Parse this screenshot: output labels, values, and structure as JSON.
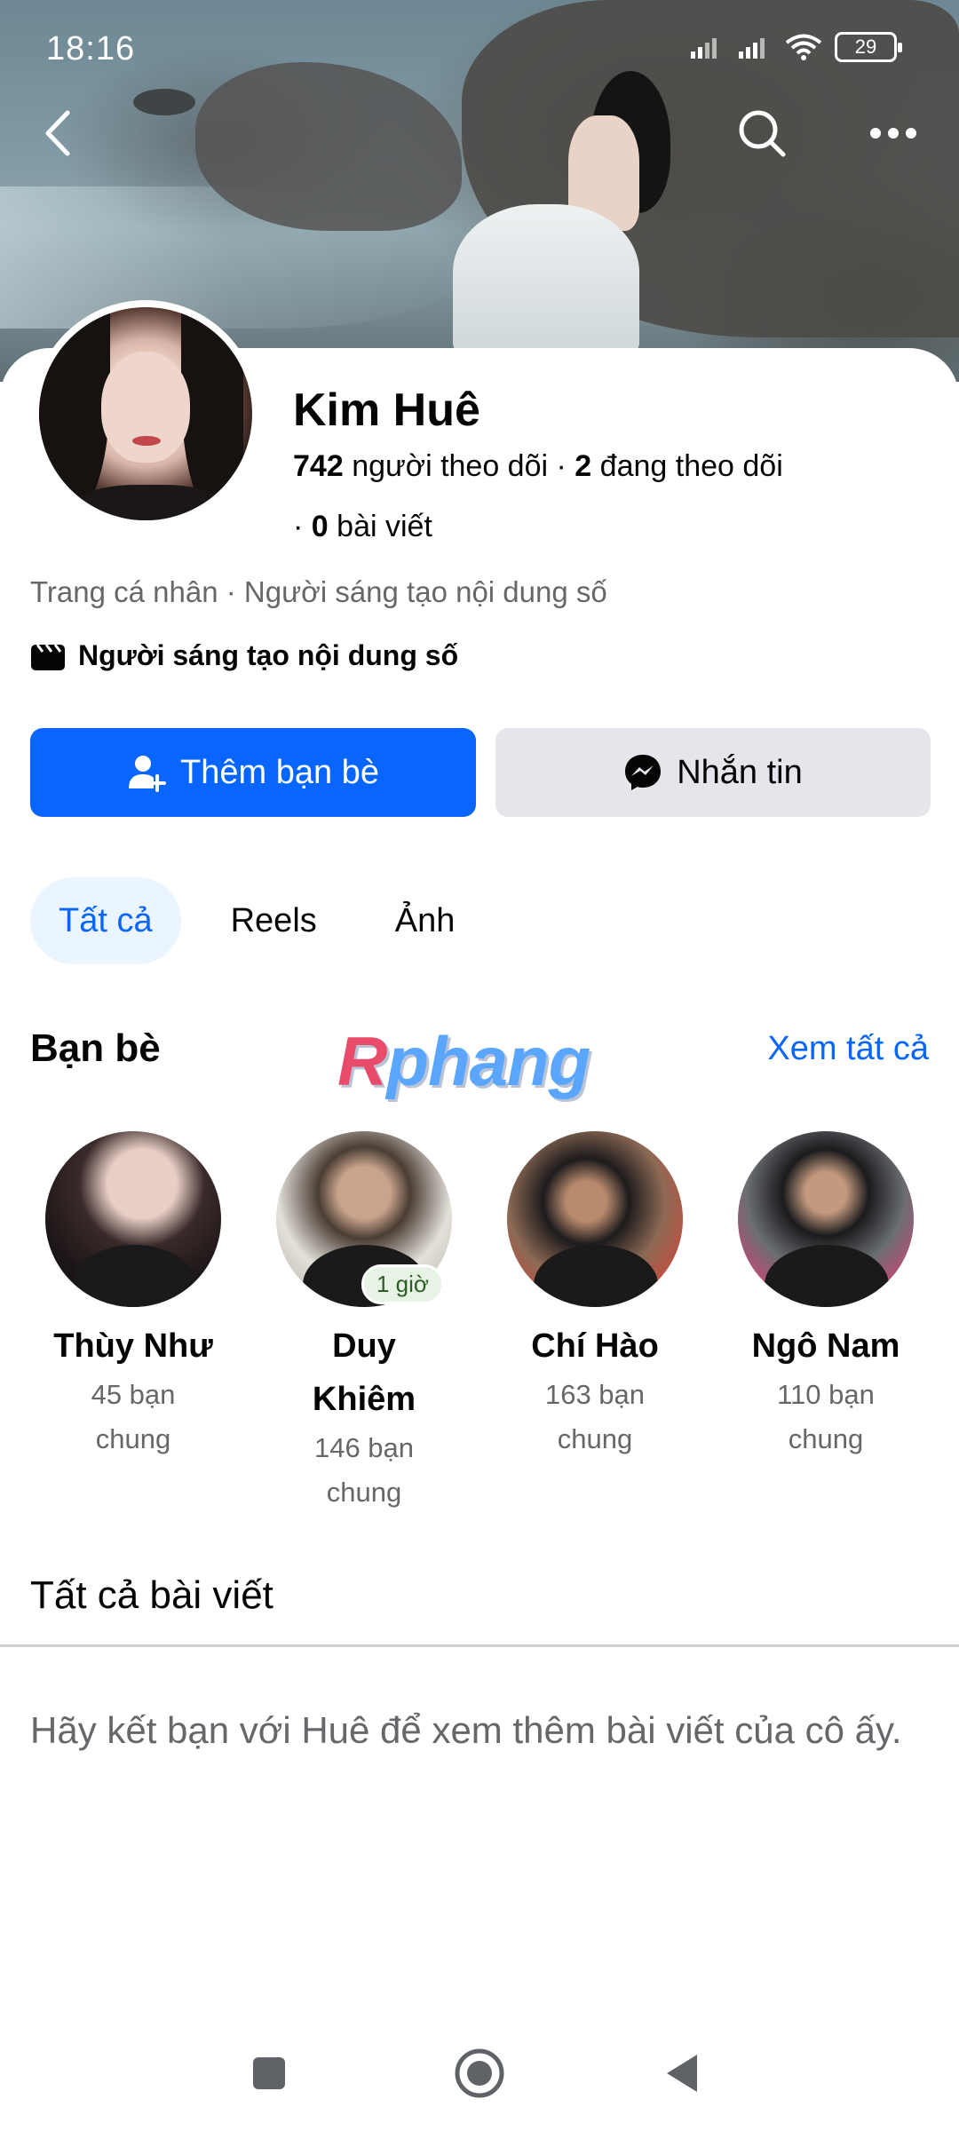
{
  "status_bar": {
    "time": "18:16",
    "battery": "29"
  },
  "profile": {
    "name": "Kim Huê",
    "followers_count": "742",
    "followers_label": "người theo dõi",
    "following_count": "2",
    "following_label": "đang theo dõi",
    "posts_count": "0",
    "posts_label": "bài viết",
    "subtitle": "Trang cá nhân · Người sáng tạo nội dung số",
    "category": "Người sáng tạo nội dung số"
  },
  "actions": {
    "add_friend": "Thêm bạn bè",
    "message": "Nhắn tin"
  },
  "tabs": [
    {
      "label": "Tất cả",
      "active": true
    },
    {
      "label": "Reels",
      "active": false
    },
    {
      "label": "Ảnh",
      "active": false
    }
  ],
  "friends": {
    "title": "Bạn bè",
    "see_all": "Xem tất cả",
    "watermark_a": "R",
    "watermark_b": "phang",
    "items": [
      {
        "name": "Thùy Như",
        "mutual_1": "45 bạn",
        "mutual_2": "chung",
        "badge": ""
      },
      {
        "name_1": "Duy",
        "name_2": "Khiêm",
        "mutual_1": "146 bạn",
        "mutual_2": "chung",
        "badge": "1 giờ"
      },
      {
        "name": "Chí Hào",
        "mutual_1": "163 bạn",
        "mutual_2": "chung",
        "badge": ""
      },
      {
        "name": "Ngô Nam",
        "mutual_1": "110 bạn",
        "mutual_2": "chung",
        "badge": ""
      }
    ]
  },
  "posts": {
    "title": "Tất cả bài viết",
    "empty_message": "Hãy kết bạn với Huê để xem thêm bài viết của cô ấy."
  },
  "colors": {
    "primary": "#0866ff",
    "secondary_bg": "#e4e6eb",
    "muted_text": "#65676b"
  }
}
